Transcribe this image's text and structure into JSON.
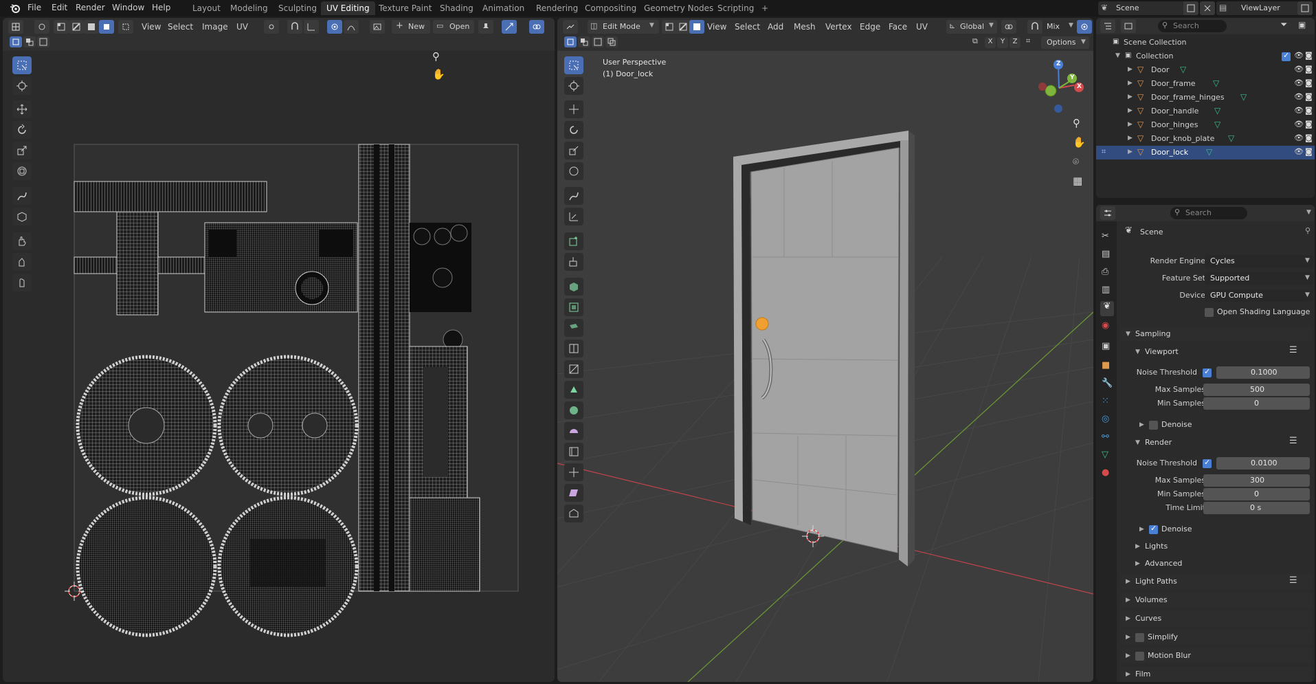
{
  "app": {
    "menus": [
      "File",
      "Edit",
      "Render",
      "Window",
      "Help"
    ],
    "workspaces": [
      "Layout",
      "Modeling",
      "Sculpting",
      "UV Editing",
      "Texture Paint",
      "Shading",
      "Animation",
      "Rendering",
      "Compositing",
      "Geometry Nodes",
      "Scripting"
    ],
    "active_workspace": "UV Editing",
    "add_workspace": "+",
    "scene_name": "Scene",
    "view_layer": "ViewLayer"
  },
  "uv_editor": {
    "menus": [
      "View",
      "Select",
      "Image",
      "UV"
    ],
    "new_label": "New",
    "open_label": "Open"
  },
  "viewport": {
    "mode": "Edit Mode",
    "menus": [
      "View",
      "Select",
      "Add",
      "Mesh",
      "Vertex",
      "Edge",
      "Face",
      "UV"
    ],
    "transform_orientation": "Global",
    "shading_mix": "Mix",
    "axes_toggles": [
      "X",
      "Y",
      "Z"
    ],
    "options_label": "Options",
    "overlay_line1": "User Perspective",
    "overlay_line2": "(1) Door_lock",
    "gizmo_axes": {
      "z": "Z",
      "y": "Y",
      "x": "X"
    }
  },
  "outliner": {
    "search_placeholder": "Search",
    "scene_collection": "Scene Collection",
    "collection": "Collection",
    "objects": [
      "Door",
      "Door_frame",
      "Door_frame_hinges",
      "Door_handle",
      "Door_hinges",
      "Door_knob_plate",
      "Door_lock"
    ],
    "selected_index": 6
  },
  "properties": {
    "search_placeholder": "Search",
    "scene_label": "Scene",
    "render_engine_label": "Render Engine",
    "render_engine_value": "Cycles",
    "feature_set_label": "Feature Set",
    "feature_set_value": "Supported",
    "device_label": "Device",
    "device_value": "GPU Compute",
    "osl_label": "Open Shading Language",
    "sampling": "Sampling",
    "viewport": "Viewport",
    "vp_noise_label": "Noise Threshold",
    "vp_noise_value": "0.1000",
    "vp_max_label": "Max Samples",
    "vp_max_value": "500",
    "vp_min_label": "Min Samples",
    "vp_min_value": "0",
    "vp_denoise": "Denoise",
    "render": "Render",
    "r_noise_label": "Noise Threshold",
    "r_noise_value": "0.0100",
    "r_max_label": "Max Samples",
    "r_max_value": "300",
    "r_min_label": "Min Samples",
    "r_min_value": "0",
    "r_time_label": "Time Limit",
    "r_time_value": "0 s",
    "r_denoise": "Denoise",
    "lights": "Lights",
    "advanced": "Advanced",
    "light_paths": "Light Paths",
    "volumes": "Volumes",
    "curves": "Curves",
    "simplify": "Simplify",
    "motion_blur": "Motion Blur",
    "film": "Film"
  },
  "colors": {
    "accent": "#4a7fd6",
    "selected_row": "#334c7f",
    "mesh_icon": "#e09a4d",
    "x_axis": "#d44b4b",
    "y_axis": "#7fb53c",
    "z_axis": "#4a7fd6"
  }
}
